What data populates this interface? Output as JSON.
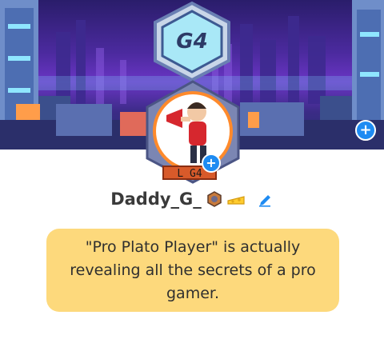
{
  "profile": {
    "frame_label": "G4",
    "level_badge": "L G4",
    "username": "Daddy_G_",
    "bio": "\"Pro Plato Player\" is actually revealing all the secrets of a pro gamer."
  },
  "icons": {
    "banner_add": "plus-icon",
    "avatar_add": "plus-icon",
    "badge_1": "hexagon-badge-icon",
    "badge_2": "cheese-badge-icon",
    "edit": "pencil-icon"
  },
  "colors": {
    "accent": "#1e8bf2",
    "bio_background": "#fdd97c",
    "username": "#3a3a3a",
    "banner_purple": "#5b2fb5"
  }
}
